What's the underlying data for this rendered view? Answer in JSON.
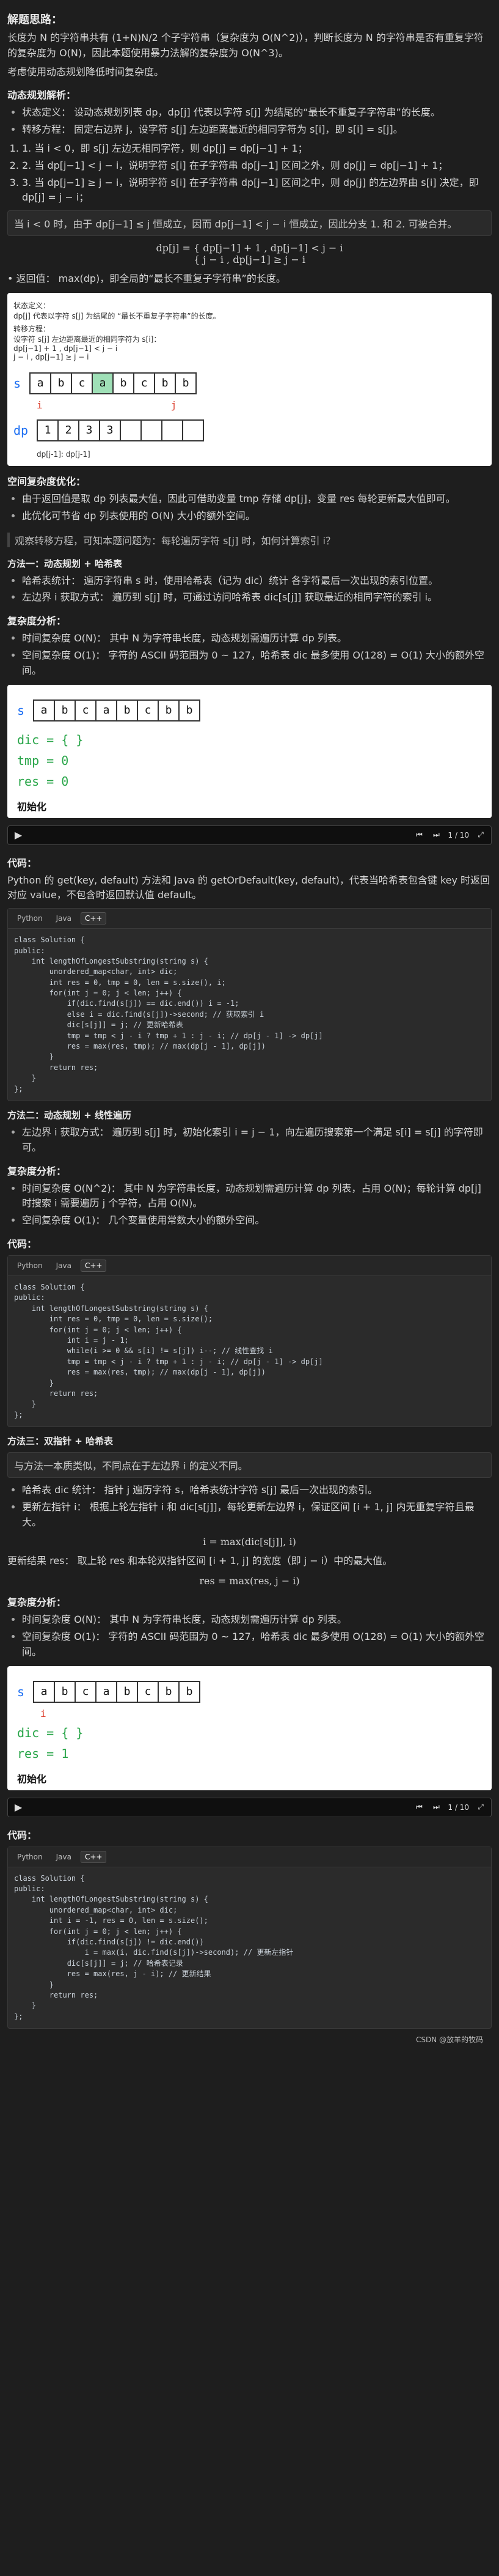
{
  "heading_main": "解题思路：",
  "intro_text": "长度为 N 的字符串共有 (1+N)N/2 个子字符串（复杂度为 O(N^2)），判断长度为 N 的字符串是否有重复字符的复杂度为 O(N)，因此本题使用暴力法解的复杂度为 O(N^3)。",
  "intro_2": "考虑使用动态规划降低时间复杂度。",
  "dp_section_title": "动态规划解析：",
  "dp_bullets": [
    "状态定义： 设动态规划列表 dp，dp[j] 代表以字符 s[j] 为结尾的“最长不重复子字符串”的长度。",
    "转移方程： 固定右边界 j，设字符 s[j] 左边距离最近的相同字符为 s[i]，即 s[i] = s[j]。"
  ],
  "dp_cases": [
    "1. 当 i < 0，即 s[j] 左边无相同字符，则 dp[j] = dp[j−1] + 1；",
    "2. 当 dp[j−1] < j − i，说明字符 s[i] 在子字符串 dp[j−1] 区间之外，则 dp[j] = dp[j−1] + 1；",
    "3. 当 dp[j−1] ≥ j − i，说明字符 s[i] 在子字符串 dp[j−1] 区间之中，则 dp[j] 的左边界由 s[i] 决定，即 dp[j] = j − i；"
  ],
  "callout_1": "当 i < 0 时，由于 dp[j−1] ≤ j 恒成立，因而 dp[j−1] < j − i 恒成立，因此分支 1. 和 2. 可被合并。",
  "formula_1_top": "dp[j] = { dp[j−1] + 1 , dp[j−1] < j − i",
  "formula_1_bottom": "        { j − i , dp[j−1] ≥ j − i",
  "return_text": "• 返回值： max(dp)，即全局的“最长不重复子字符串”的长度。",
  "figure1": {
    "title": "状态定义：",
    "line": "dp[j] 代表以字符 s[j] 为结尾的 “最长不重复子字符串”的长度。",
    "trans": "转移方程：",
    "trans_desc": "设字符 s[j] 左边距离最近的相同字符为 s[i]：",
    "eq_top": "dp[j−1] + 1 , dp[j−1] < j − i",
    "eq_bottom": "j − i , dp[j−1] ≥ j − i",
    "s_label": "s",
    "s_chars": [
      "a",
      "b",
      "c",
      "a",
      "b",
      "c",
      "b",
      "b"
    ],
    "dp_label": "dp",
    "dp_vals": [
      "1",
      "2",
      "3",
      "3",
      "",
      "",
      "",
      ""
    ],
    "i_label": "i",
    "j_label": "j",
    "bottom_label": "dp[j-1]: dp[j-1]"
  },
  "space_section_title": "空间复杂度优化：",
  "space_bullets": [
    "由于返回值是取 dp 列表最大值，因此可借助变量 tmp 存储 dp[j]，变量 res 每轮更新最大值即可。",
    "此优化可节省 dp 列表使用的 O(N) 大小的额外空间。"
  ],
  "observe_text": "观察转移方程，可知本题问题为：每轮遍历字符 s[j] 时，如何计算索引 i？",
  "m1_title": "方法一：动态规划 + 哈希表",
  "m1_bullets": [
    "哈希表统计： 遍历字符串 s 时，使用哈希表（记为 dic）统计 各字符最后一次出现的索引位置。",
    "左边界 i 获取方式： 遍历到 s[j] 时，可通过访问哈希表 dic[s[j]] 获取最近的相同字符的索引 i。"
  ],
  "m1_complex_title": "复杂度分析：",
  "m1_complex": [
    "时间复杂度 O(N)： 其中 N 为字符串长度，动态规划需遍历计算 dp 列表。",
    "空间复杂度 O(1)： 字符的 ASCII 码范围为 0 ~ 127，哈希表 dic 最多使用 O(128) = O(1) 大小的额外空间。"
  ],
  "slide1": {
    "s_label": "s",
    "chars": [
      "a",
      "b",
      "c",
      "a",
      "b",
      "c",
      "b",
      "b"
    ],
    "dic_line": "dic = { }",
    "tmp_line": "tmp = 0",
    "res_line": "res = 0",
    "init_text": "初始化",
    "progress": "1 / 10"
  },
  "code_label": "代码：",
  "m1_code_desc": "Python 的 get(key, default) 方法和 Java 的 getOrDefault(key, default)，代表当哈希表包含键 key 时返回对应 value，不包含时返回默认值 default。",
  "tabs": [
    "Python",
    "Java",
    "C++"
  ],
  "m1_cpp_code": "class Solution {\npublic:\n    int lengthOfLongestSubstring(string s) {\n        unordered_map<char, int> dic;\n        int res = 0, tmp = 0, len = s.size(), i;\n        for(int j = 0; j < len; j++) {\n            if(dic.find(s[j]) == dic.end()) i = -1;\n            else i = dic.find(s[j])->second; // 获取索引 i\n            dic[s[j]] = j; // 更新哈希表\n            tmp = tmp < j - i ? tmp + 1 : j - i; // dp[j - 1] -> dp[j]\n            res = max(res, tmp); // max(dp[j - 1], dp[j])\n        }\n        return res;\n    }\n};",
  "m2_title": "方法二：动态规划 + 线性遍历",
  "m2_bullets": [
    "左边界 i 获取方式： 遍历到 s[j] 时，初始化索引 i = j − 1，向左遍历搜索第一个满足 s[i] = s[j] 的字符即可。"
  ],
  "m2_complex_title": "复杂度分析：",
  "m2_complex": [
    "时间复杂度 O(N^2)： 其中 N 为字符串长度，动态规划需遍历计算 dp 列表，占用 O(N)；每轮计算 dp[j] 时搜索 i 需要遍历 j 个字符，占用 O(N)。",
    "空间复杂度 O(1)： 几个变量使用常数大小的额外空间。"
  ],
  "m2_cpp_code": "class Solution {\npublic:\n    int lengthOfLongestSubstring(string s) {\n        int res = 0, tmp = 0, len = s.size();\n        for(int j = 0; j < len; j++) {\n            int i = j - 1;\n            while(i >= 0 && s[i] != s[j]) i--; // 线性查找 i\n            tmp = tmp < j - i ? tmp + 1 : j - i; // dp[j - 1] -> dp[j]\n            res = max(res, tmp); // max(dp[j - 1], dp[j])\n        }\n        return res;\n    }\n};",
  "m3_title": "方法三：双指针 + 哈希表",
  "m3_callout": "与方法一本质类似，不同点在于左边界 i 的定义不同。",
  "m3_bullets": [
    "哈希表 dic 统计： 指针 j 遍历字符 s，哈希表统计字符 s[j] 最后一次出现的索引。",
    "更新左指针 i： 根据上轮左指针 i 和 dic[s[j]]，每轮更新左边界 i，保证区间 [i + 1, j] 内无重复字符且最大。"
  ],
  "m3_formula": "i = max(dic[s[j]], i)",
  "m3_result": "更新结果 res： 取上轮 res 和本轮双指针区间 [i + 1, j] 的宽度（即 j − i）中的最大值。",
  "m3_result_formula": "res = max(res, j − i)",
  "m3_complex_title": "复杂度分析：",
  "m3_complex": [
    "时间复杂度 O(N)： 其中 N 为字符串长度，动态规划需遍历计算 dp 列表。",
    "空间复杂度 O(1)： 字符的 ASCII 码范围为 0 ~ 127，哈希表 dic 最多使用 O(128) = O(1) 大小的额外空间。"
  ],
  "slide2": {
    "s_label": "s",
    "chars": [
      "a",
      "b",
      "c",
      "a",
      "b",
      "c",
      "b",
      "b"
    ],
    "i_label": "i",
    "dic_line": "dic = { }",
    "res_line": "res = 1",
    "init_text": "初始化",
    "progress": "1 / 10"
  },
  "m3_cpp_code": "class Solution {\npublic:\n    int lengthOfLongestSubstring(string s) {\n        unordered_map<char, int> dic;\n        int i = -1, res = 0, len = s.size();\n        for(int j = 0; j < len; j++) {\n            if(dic.find(s[j]) != dic.end())\n                i = max(i, dic.find(s[j])->second); // 更新左指针\n            dic[s[j]] = j; // 哈希表记录\n            res = max(res, j - i); // 更新结果\n        }\n        return res;\n    }\n};",
  "watermark": "CSDN @放羊的牧码"
}
